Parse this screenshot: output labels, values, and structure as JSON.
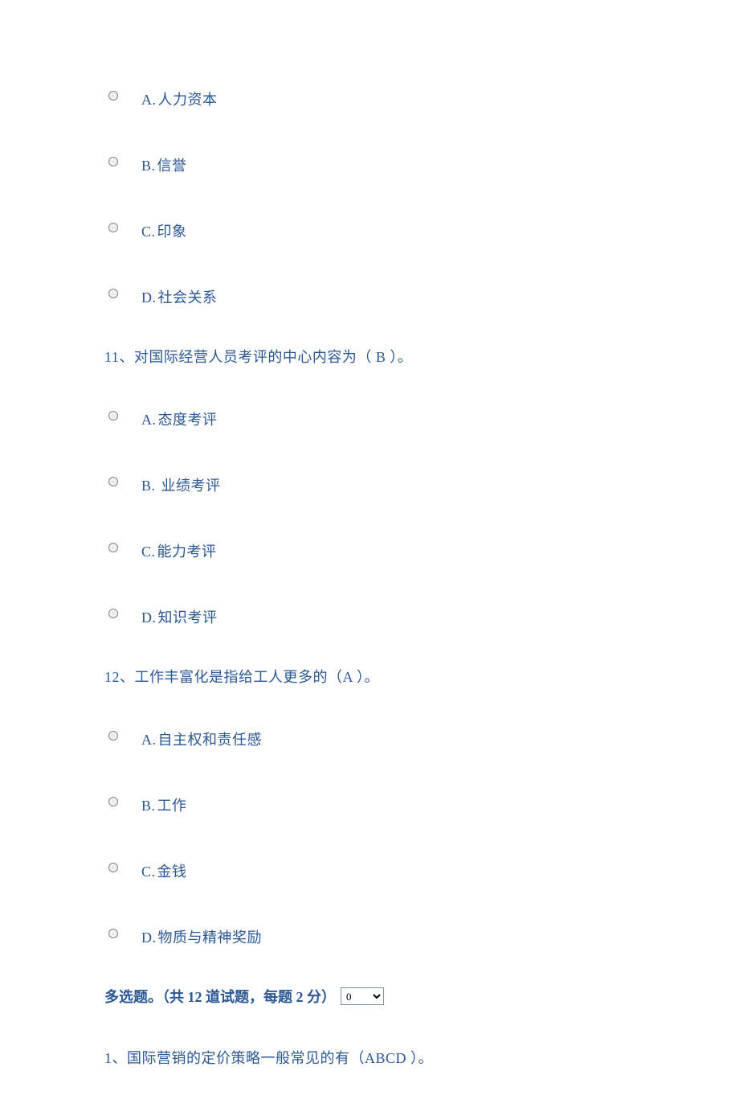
{
  "q10_options": [
    {
      "letter": "A.",
      "text": "人力资本"
    },
    {
      "letter": "B.",
      "text": "信誉"
    },
    {
      "letter": "C.",
      "text": "印象"
    },
    {
      "letter": "D.",
      "text": "社会关系"
    }
  ],
  "q11": {
    "text": "11、对国际经营人员考评的中心内容为（  B ）。",
    "options": [
      {
        "letter": "A.",
        "text": "态度考评"
      },
      {
        "letter": "B.",
        "text": "  业绩考评"
      },
      {
        "letter": "C.",
        "text": "能力考评"
      },
      {
        "letter": "D.",
        "text": "知识考评"
      }
    ]
  },
  "q12": {
    "text": "12、工作丰富化是指给工人更多的（A  ）。",
    "options": [
      {
        "letter": "A.",
        "text": "自主权和责任感"
      },
      {
        "letter": "B.",
        "text": "工作"
      },
      {
        "letter": "C.",
        "text": "金钱"
      },
      {
        "letter": "D.",
        "text": "物质与精神奖励"
      }
    ]
  },
  "section": {
    "title": "多选题。（共 12 道试题，每题 2 分）",
    "select_value": "0"
  },
  "mc_q1": {
    "text": "1、国际营销的定价策略一般常见的有（ABCD  ）。"
  }
}
